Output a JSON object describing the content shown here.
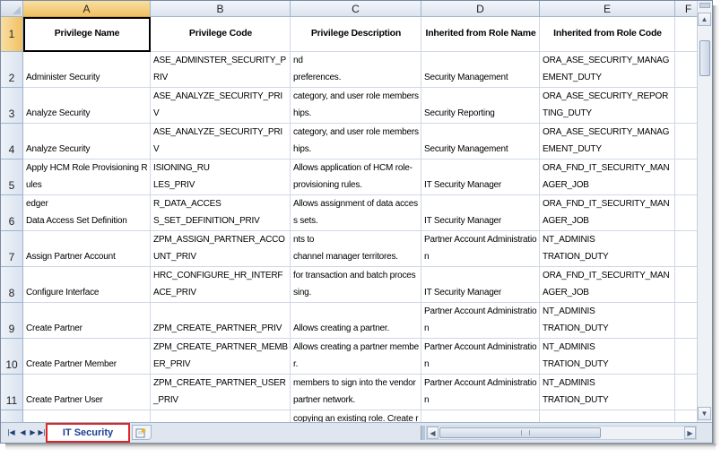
{
  "columns": [
    "A",
    "B",
    "C",
    "D",
    "E",
    "F"
  ],
  "headers": [
    "Privilege Name",
    "Privilege Code",
    "Privilege Description",
    "Inherited from Role Name",
    "Inherited from Role Code"
  ],
  "rows": [
    {
      "num": "1"
    },
    {
      "num": "2",
      "cells": [
        "Administer Security",
        "ASE_ADMINSTER_SECURITY_PRIV",
        "Manage security configuration and\npreferences.",
        "Security Management",
        "ORA_ASE_SECURITY_MANAGEMENT_DUTY"
      ]
    },
    {
      "num": "3",
      "cells": [
        "Analyze Security",
        "ASE_ANALYZE_SECURITY_PRIV",
        "Analyze security including roles by\ncategory, and user role memberships.",
        "Security Reporting",
        "ORA_ASE_SECURITY_REPORTING_DUTY"
      ]
    },
    {
      "num": "4",
      "cells": [
        "Analyze Security",
        "ASE_ANALYZE_SECURITY_PRIV",
        "Analyze security including roles by\ncategory, and user role memberships.",
        "Security Management",
        "ORA_ASE_SECURITY_MANAGEMENT_DUTY"
      ]
    },
    {
      "num": "5",
      "cells": [
        "Apply HCM Role Provisioning Rules",
        "PER_APPLY_HCM_ROLE_PROVISIONING_RU\nLES_PRIV",
        "Allows application of HCM role-\nprovisioning rules.",
        "IT Security Manager",
        "ORA_FND_IT_SECURITY_MANAGER_JOB"
      ]
    },
    {
      "num": "6",
      "cells": [
        "Assign Oracle Fusion General Ledger\nData Access Set Definition",
        "GL_ASSIGN_GENERAL_LEDGER_DATA_ACCES\nS_SET_DEFINITION_PRIV",
        "Allows assignment of data access sets.",
        "IT Security Manager",
        "ORA_FND_IT_SECURITY_MANAGER_JOB"
      ]
    },
    {
      "num": "7",
      "cells": [
        "Assign Partner Account",
        "ZPM_ASSIGN_PARTNER_ACCOUNT_PRIV",
        "Privilege to assign partner accounts to\nchannel manager territores.",
        "Partner Account Administration",
        "ORA_ZPM_PARTNER_ACCOUNT_ADMINIS\nTRATION_DUTY"
      ]
    },
    {
      "num": "8",
      "cells": [
        "Configure Interface",
        "HRC_CONFIGURE_HR_INTERFACE_PRIV",
        "Allows configuration of the interface\nfor transaction and batch processing.",
        "IT Security Manager",
        "ORA_FND_IT_SECURITY_MANAGER_JOB"
      ]
    },
    {
      "num": "9",
      "cells": [
        "Create Partner",
        "ZPM_CREATE_PARTNER_PRIV",
        "Allows creating a partner.",
        "Partner Account Administration",
        "ORA_ZPM_PARTNER_ACCOUNT_ADMINIS\nTRATION_DUTY"
      ]
    },
    {
      "num": "10",
      "cells": [
        "Create Partner Member",
        "ZPM_CREATE_PARTNER_MEMBER_PRIV",
        "Allows creating a partner member.",
        "Partner Account Administration",
        "ORA_ZPM_PARTNER_ACCOUNT_ADMINIS\nTRATION_DUTY"
      ]
    },
    {
      "num": "11",
      "cells": [
        "Create Partner User",
        "ZPM_CREATE_PARTNER_USER_PRIV",
        "members to sign into the vendor\npartner network.",
        "Partner Account Administration",
        "ORA_ZPM_PARTNER_ACCOUNT_ADMINIS\nTRATION_DUTY"
      ]
    },
    {
      "num": "",
      "cells": [
        "",
        "",
        "copying an existing role. Create role",
        "",
        ""
      ]
    }
  ],
  "sheet_tab": "IT Security Manager",
  "icons": {
    "nav_first": "first-sheet-icon",
    "nav_prev": "prev-sheet-icon",
    "nav_next": "next-sheet-icon",
    "nav_last": "last-sheet-icon",
    "insert_sheet": "insert-sheet-icon"
  },
  "colors": {
    "selected_header": "#f0c063",
    "tab_highlight": "#e02424",
    "tab_text": "#1b3f8f",
    "gridline": "#d0d7e5"
  }
}
